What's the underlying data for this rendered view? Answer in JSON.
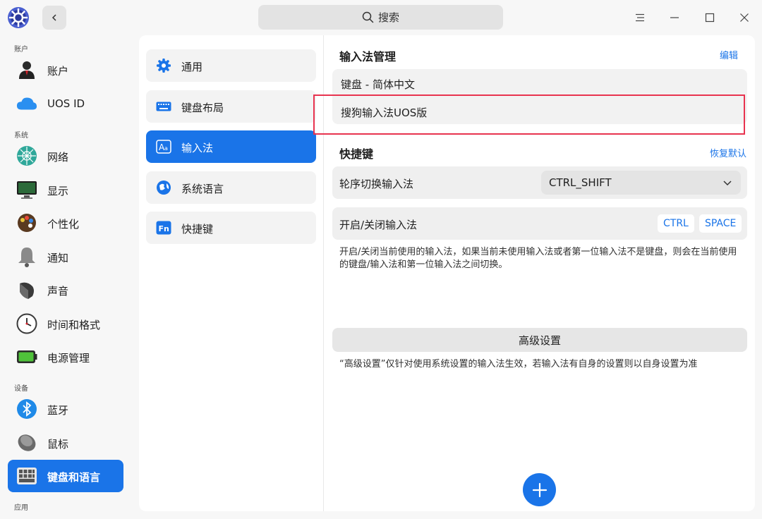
{
  "titlebar": {
    "search_placeholder": "搜索",
    "icons": [
      "app-logo-icon",
      "back-icon",
      "search-icon",
      "menu-icon",
      "minimize-icon",
      "maximize-icon",
      "close-icon"
    ]
  },
  "sidebar": {
    "groups": {
      "account": "账户",
      "system": "系统",
      "device": "设备",
      "app": "应用"
    },
    "items": [
      {
        "label": "账户",
        "icon": "user-avatar-icon"
      },
      {
        "label": "UOS ID",
        "icon": "cloud-icon"
      },
      {
        "label": "网络",
        "icon": "network-icon"
      },
      {
        "label": "显示",
        "icon": "monitor-icon"
      },
      {
        "label": "个性化",
        "icon": "palette-icon"
      },
      {
        "label": "通知",
        "icon": "bell-icon"
      },
      {
        "label": "声音",
        "icon": "speaker-icon"
      },
      {
        "label": "时间和格式",
        "icon": "clock-icon"
      },
      {
        "label": "电源管理",
        "icon": "battery-icon"
      },
      {
        "label": "蓝牙",
        "icon": "bluetooth-icon"
      },
      {
        "label": "鼠标",
        "icon": "mouse-icon"
      },
      {
        "label": "键盘和语言",
        "icon": "keyboard-icon",
        "active": true
      }
    ]
  },
  "subnav": {
    "items": [
      {
        "label": "通用",
        "icon": "gear-icon"
      },
      {
        "label": "键盘布局",
        "icon": "keyboard-layout-icon"
      },
      {
        "label": "输入法",
        "icon": "input-method-icon",
        "active": true
      },
      {
        "label": "系统语言",
        "icon": "globe-icon"
      },
      {
        "label": "快捷键",
        "icon": "fn-key-icon"
      }
    ]
  },
  "main": {
    "im_section": {
      "title": "输入法管理",
      "edit_label": "编辑",
      "methods": [
        "键盘 - 简体中文",
        "搜狗输入法UOS版"
      ]
    },
    "shortcut_section": {
      "title": "快捷键",
      "reset_label": "恢复默认",
      "switch_row": {
        "label": "轮序切换输入法",
        "value": "CTRL_SHIFT"
      },
      "toggle_row": {
        "label": "开启/关闭输入法",
        "keys": [
          "CTRL",
          "SPACE"
        ]
      },
      "description": "开启/关闭当前使用的输入法，如果当前未使用输入法或者第一位输入法不是键盘，则会在当前使用的键盘/输入法和第一位输入法之间切换。"
    },
    "advanced": {
      "button_label": "高级设置",
      "note": "“高级设置”仅针对使用系统设置的输入法生效，若输入法有自身的设置则以自身设置为准"
    },
    "colors": {
      "accent": "#1a74e8",
      "highlight_border": "#e8334f"
    }
  }
}
